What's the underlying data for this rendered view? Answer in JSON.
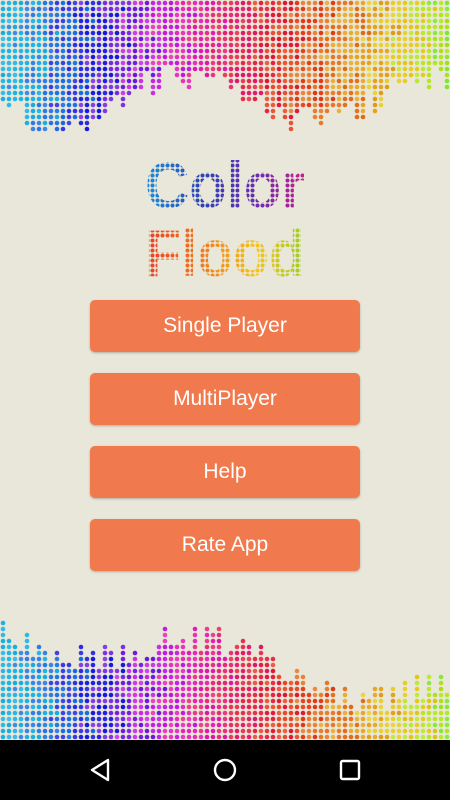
{
  "app": {
    "logo_line1": "Color",
    "logo_line2": "Flood"
  },
  "menu": {
    "single_player": "Single Player",
    "multiplayer": "MultiPlayer",
    "help": "Help",
    "rate_app": "Rate App"
  },
  "navbar": {
    "back_icon": "back-triangle",
    "home_icon": "home-circle",
    "recents_icon": "recents-square"
  },
  "colors": {
    "background": "#e9e7d9",
    "button": "#f07a4d",
    "button_text": "#ffffff",
    "navbar": "#000000"
  }
}
